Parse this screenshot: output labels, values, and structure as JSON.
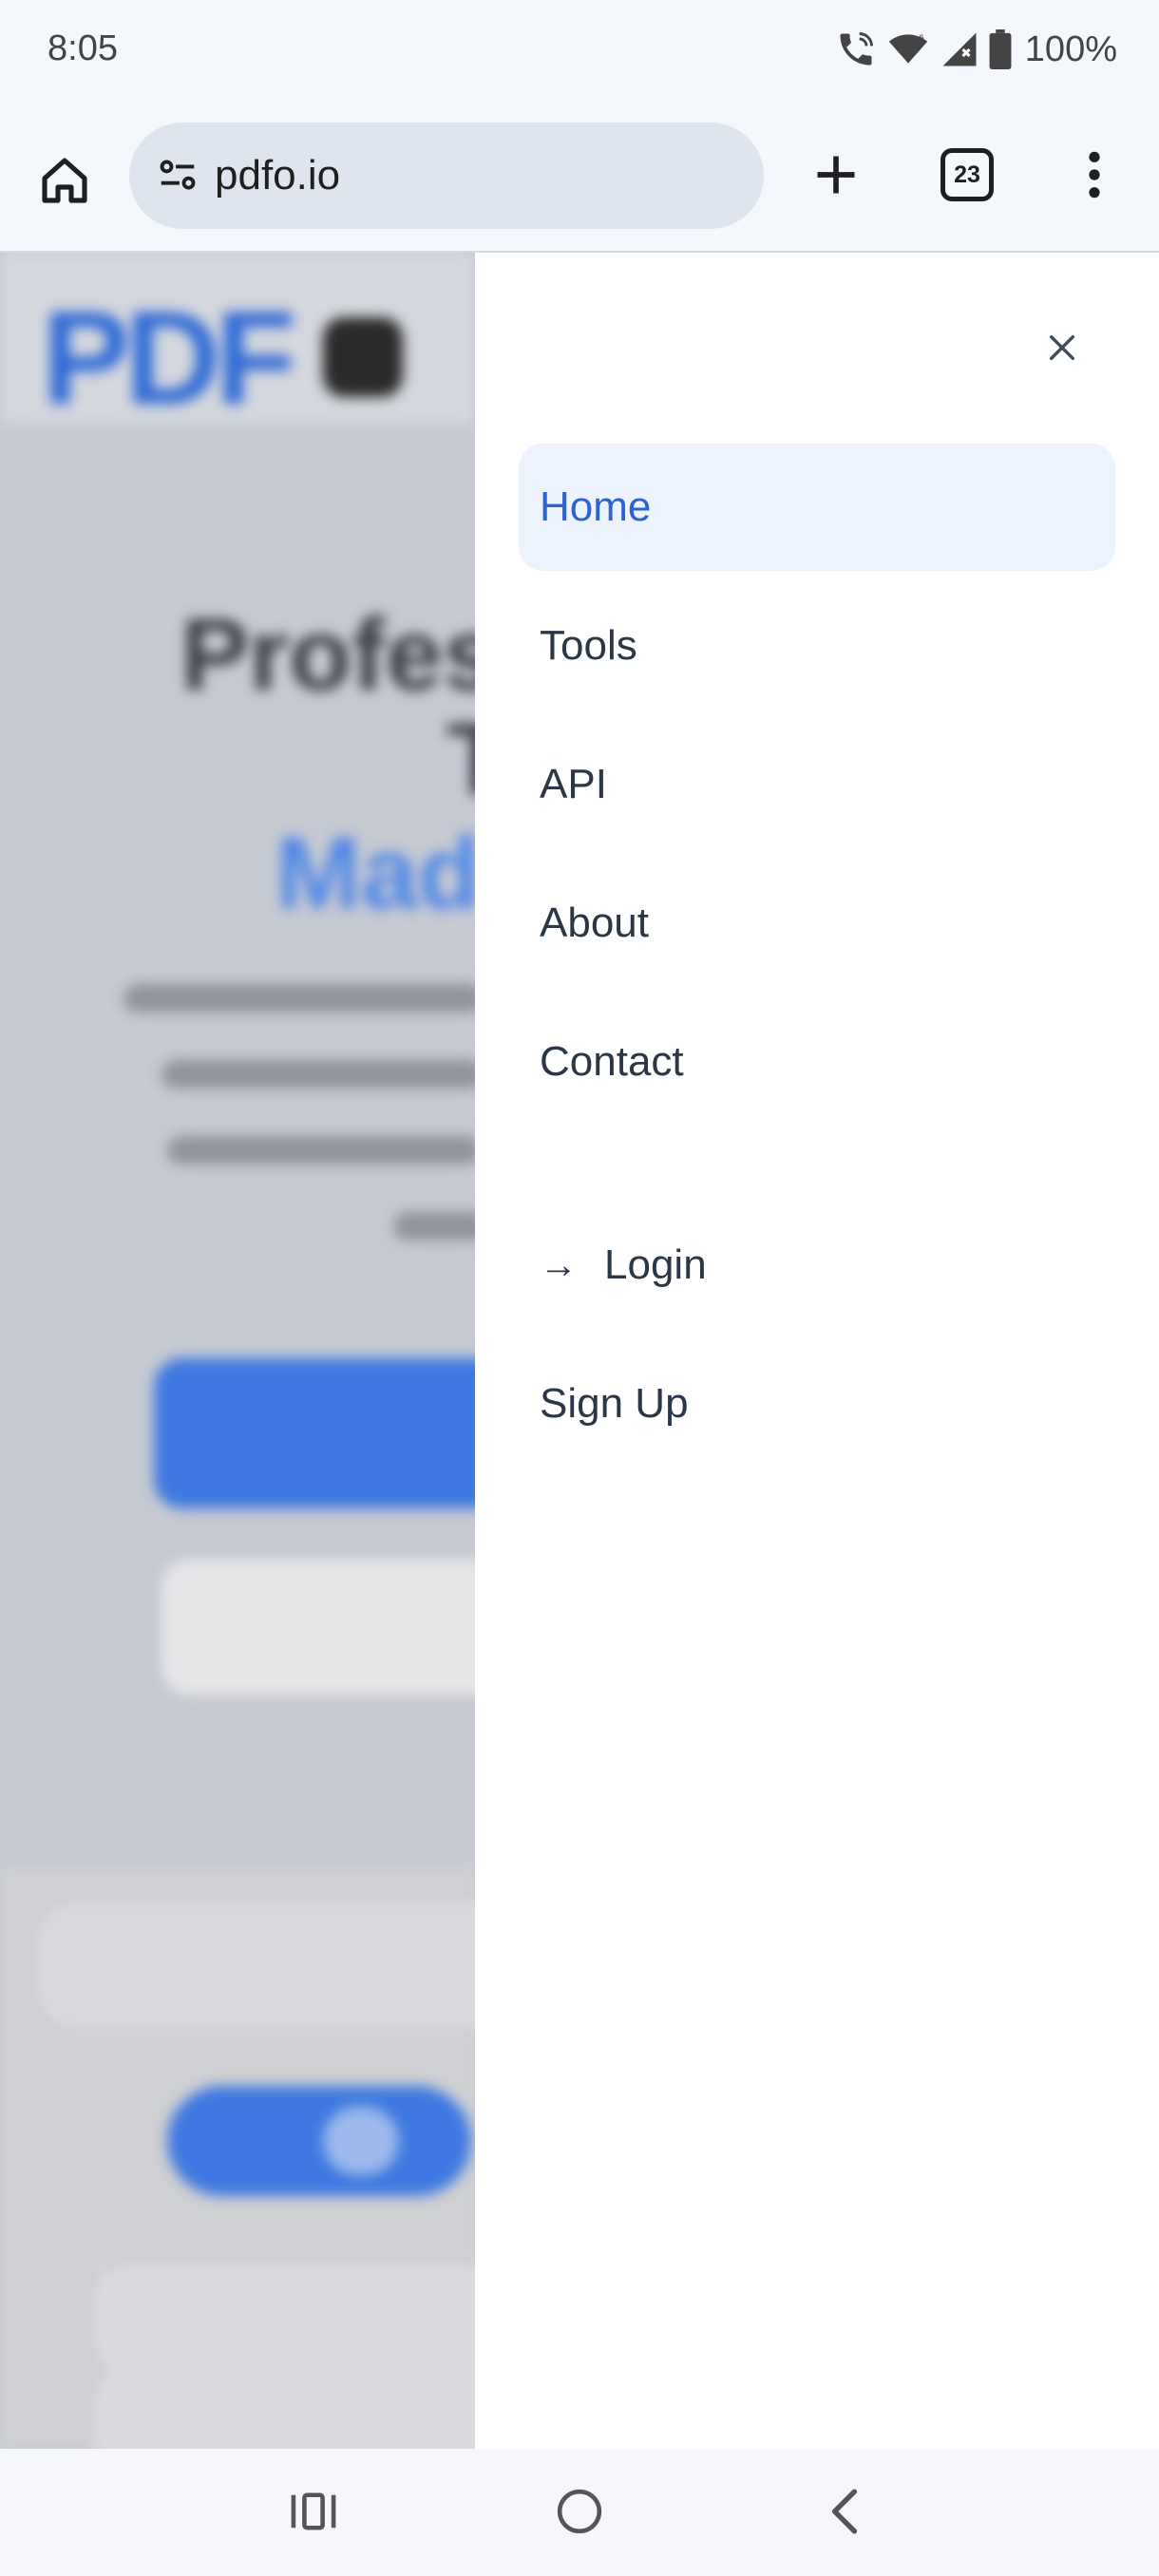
{
  "status_bar": {
    "time": "8:05",
    "battery": "100%",
    "icons": [
      "wifi-calling-icon",
      "wifi-icon",
      "cell-signal-icon",
      "battery-icon"
    ]
  },
  "browser": {
    "url": "pdfo.io",
    "tab_count": "23",
    "icons": [
      "home-icon",
      "site-settings-icon",
      "new-tab-icon",
      "tab-switcher-icon",
      "more-menu-icon"
    ]
  },
  "drawer": {
    "nav_items": [
      {
        "label": "Home",
        "active": true
      },
      {
        "label": "Tools",
        "active": false
      },
      {
        "label": "API",
        "active": false
      },
      {
        "label": "About",
        "active": false
      },
      {
        "label": "Contact",
        "active": false
      }
    ],
    "login_arrow": "→",
    "login_label": "Login",
    "signup_label": "Sign Up",
    "close_icon": "close-icon"
  },
  "colors": {
    "accent": "#2c64d2",
    "active_bg": "#edf3fd",
    "nav_text": "#2b3646"
  }
}
